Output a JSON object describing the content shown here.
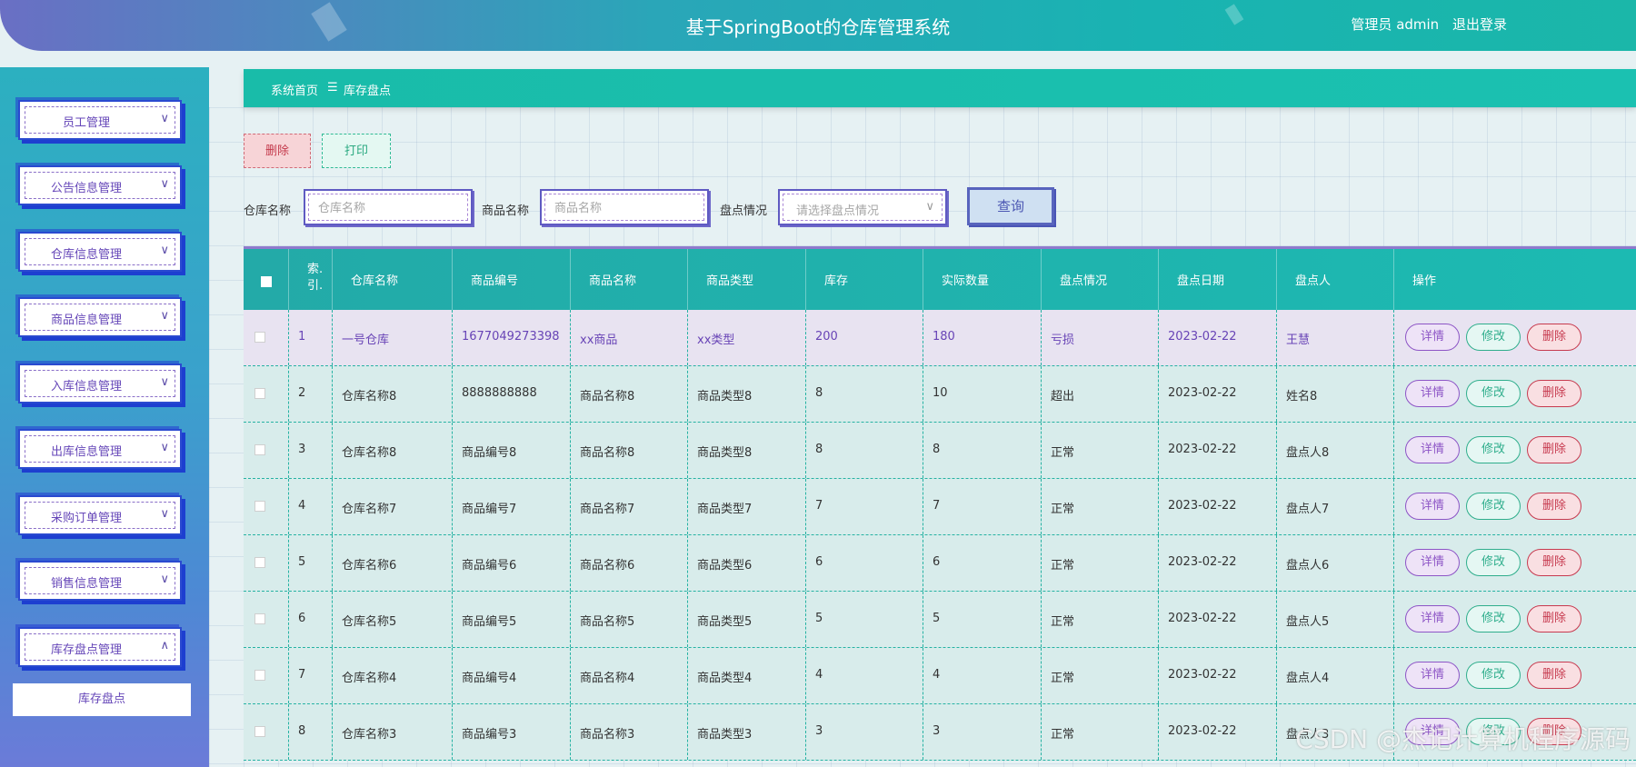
{
  "header": {
    "title": "基于SpringBoot的仓库管理系统",
    "user": "管理员 admin",
    "logout": "退出登录"
  },
  "sidebar": {
    "items": [
      {
        "label": "员工管理",
        "chev": "∨"
      },
      {
        "label": "公告信息管理",
        "chev": "∨"
      },
      {
        "label": "仓库信息管理",
        "chev": "∨"
      },
      {
        "label": "商品信息管理",
        "chev": "∨"
      },
      {
        "label": "入库信息管理",
        "chev": "∨"
      },
      {
        "label": "出库信息管理",
        "chev": "∨"
      },
      {
        "label": "采购订单管理",
        "chev": "∨"
      },
      {
        "label": "销售信息管理",
        "chev": "∨"
      },
      {
        "label": "库存盘点管理",
        "chev": "∧"
      }
    ],
    "submenu": "库存盘点"
  },
  "breadcrumb": {
    "home": "系统首页",
    "separator": "☰",
    "current": "库存盘点"
  },
  "toolbar": {
    "delete": "删除",
    "print": "打印"
  },
  "filters": {
    "warehouse_label": "仓库名称",
    "warehouse_placeholder": "仓库名称",
    "product_label": "商品名称",
    "product_placeholder": "商品名称",
    "status_label": "盘点情况",
    "status_placeholder": "请选择盘点情况",
    "search": "查询"
  },
  "table": {
    "headers": [
      "",
      "索引",
      "仓库名称",
      "商品编号",
      "商品名称",
      "商品类型",
      "库存",
      "实际数量",
      "盘点情况",
      "盘点日期",
      "盘点人",
      "操作"
    ],
    "header_index_line1": "索.",
    "header_index_line2": "引.",
    "actions": {
      "detail": "详情",
      "edit": "修改",
      "delete": "删除"
    },
    "rows": [
      {
        "index": "1",
        "warehouse": "一号仓库",
        "code": "1677049273398",
        "name": "xx商品",
        "type": "xx类型",
        "stock": "200",
        "actual": "180",
        "status": "亏损",
        "date": "2023-02-22",
        "person": "王慧"
      },
      {
        "index": "2",
        "warehouse": "仓库名称8",
        "code": "8888888888",
        "name": "商品名称8",
        "type": "商品类型8",
        "stock": "8",
        "actual": "10",
        "status": "超出",
        "date": "2023-02-22",
        "person": "姓名8"
      },
      {
        "index": "3",
        "warehouse": "仓库名称8",
        "code": "商品编号8",
        "name": "商品名称8",
        "type": "商品类型8",
        "stock": "8",
        "actual": "8",
        "status": "正常",
        "date": "2023-02-22",
        "person": "盘点人8"
      },
      {
        "index": "4",
        "warehouse": "仓库名称7",
        "code": "商品编号7",
        "name": "商品名称7",
        "type": "商品类型7",
        "stock": "7",
        "actual": "7",
        "status": "正常",
        "date": "2023-02-22",
        "person": "盘点人7"
      },
      {
        "index": "5",
        "warehouse": "仓库名称6",
        "code": "商品编号6",
        "name": "商品名称6",
        "type": "商品类型6",
        "stock": "6",
        "actual": "6",
        "status": "正常",
        "date": "2023-02-22",
        "person": "盘点人6"
      },
      {
        "index": "6",
        "warehouse": "仓库名称5",
        "code": "商品编号5",
        "name": "商品名称5",
        "type": "商品类型5",
        "stock": "5",
        "actual": "5",
        "status": "正常",
        "date": "2023-02-22",
        "person": "盘点人5"
      },
      {
        "index": "7",
        "warehouse": "仓库名称4",
        "code": "商品编号4",
        "name": "商品名称4",
        "type": "商品类型4",
        "stock": "4",
        "actual": "4",
        "status": "正常",
        "date": "2023-02-22",
        "person": "盘点人4"
      },
      {
        "index": "8",
        "warehouse": "仓库名称3",
        "code": "商品编号3",
        "name": "商品名称3",
        "type": "商品类型3",
        "stock": "3",
        "actual": "3",
        "status": "正常",
        "date": "2023-02-22",
        "person": "盘点人3"
      }
    ]
  },
  "watermark": "CSDN @杰记计算机程序源码"
}
